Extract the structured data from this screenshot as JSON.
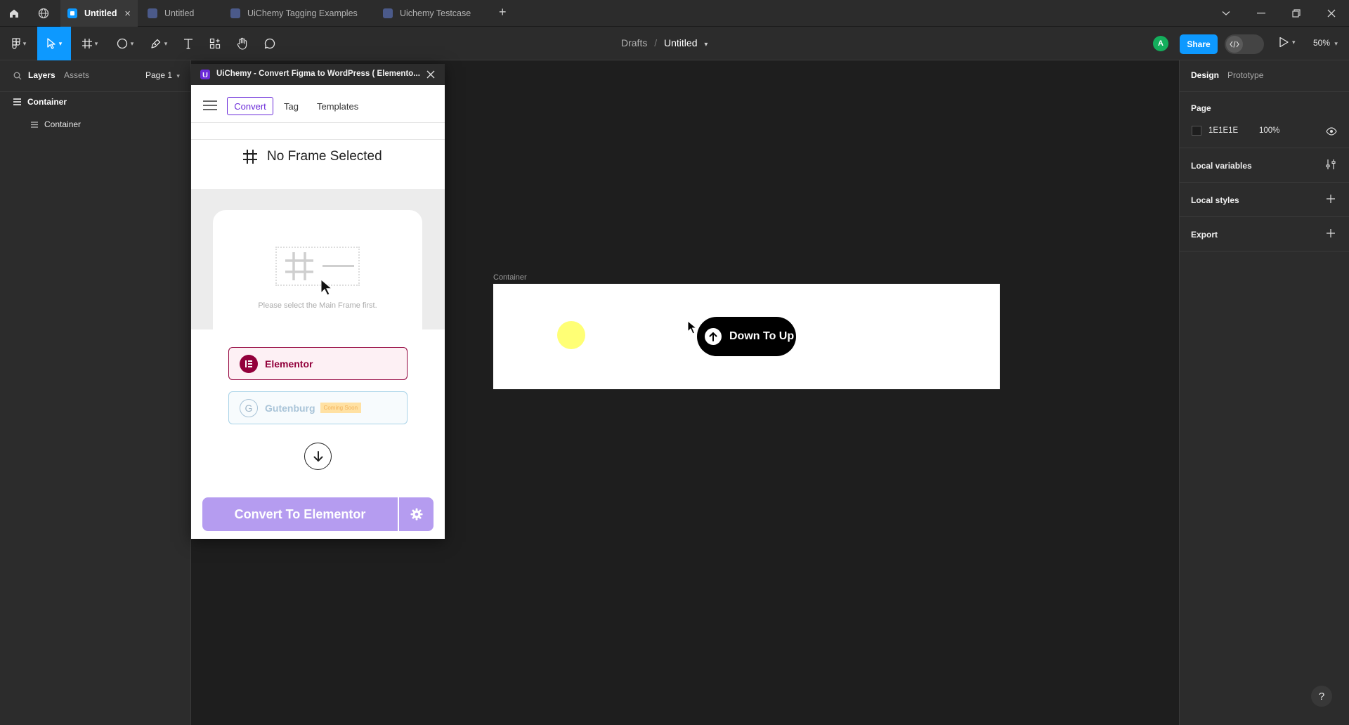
{
  "tabbar": {
    "tabs": [
      {
        "label": "Untitled",
        "active": true
      },
      {
        "label": "Untitled",
        "active": false
      },
      {
        "label": "UiChemy Tagging Examples",
        "active": false
      },
      {
        "label": "Uichemy Testcase",
        "active": false
      }
    ],
    "close_glyph": "×",
    "add_glyph": "+"
  },
  "toolbar": {
    "breadcrumb_parent": "Drafts",
    "breadcrumb_sep": "/",
    "file_title": "Untitled",
    "avatar_letter": "A",
    "share_label": "Share",
    "zoom": "50%"
  },
  "leftpanel": {
    "tab_layers": "Layers",
    "tab_assets": "Assets",
    "page_select": "Page 1",
    "layers": [
      {
        "label": "Container",
        "level": 0
      },
      {
        "label": "Container",
        "level": 1
      }
    ]
  },
  "plugin": {
    "title": "UiChemy - Convert Figma to WordPress ( Elemento...",
    "tabs": {
      "convert": "Convert",
      "tag": "Tag",
      "templates": "Templates"
    },
    "no_frame": "No Frame Selected",
    "hint": "Please select the Main Frame first.",
    "elementor_label": "Elementor",
    "gutenburg_label": "Gutenburg",
    "coming_soon": "Coming Soon",
    "convert_button": "Convert To Elementor"
  },
  "canvas": {
    "frame_label": "Container",
    "button_label": "Down To Up"
  },
  "rightpanel": {
    "tab_design": "Design",
    "tab_prototype": "Prototype",
    "page_heading": "Page",
    "page_color": "1E1E1E",
    "page_opacity": "100%",
    "local_variables": "Local variables",
    "local_styles": "Local styles",
    "export": "Export"
  },
  "help": "?",
  "colors": {
    "accent": "#0d99ff",
    "canvas_bg": "#1e1e1e",
    "panel_bg": "#2c2c2c",
    "elementor": "#92003b",
    "convert_purple": "#b59cf0",
    "avatar_green": "#14ae5c",
    "highlight_yellow": "#ffff66"
  },
  "icons": [
    "home-icon",
    "globe-icon",
    "figma-file-icon",
    "chevron-down-icon",
    "minimize-icon",
    "maximize-icon",
    "close-icon",
    "figma-menu-icon",
    "move-icon",
    "frame-icon",
    "ellipse-icon",
    "pen-icon",
    "text-icon",
    "components-icon",
    "hand-icon",
    "comment-icon",
    "dev-mode-icon",
    "play-icon",
    "search-icon",
    "hamburger-icon",
    "hash-icon",
    "arrow-down-circle-icon",
    "gear-icon",
    "arrow-up-circle-icon",
    "eye-icon",
    "variables-icon",
    "plus-icon",
    "cursor-icon"
  ]
}
